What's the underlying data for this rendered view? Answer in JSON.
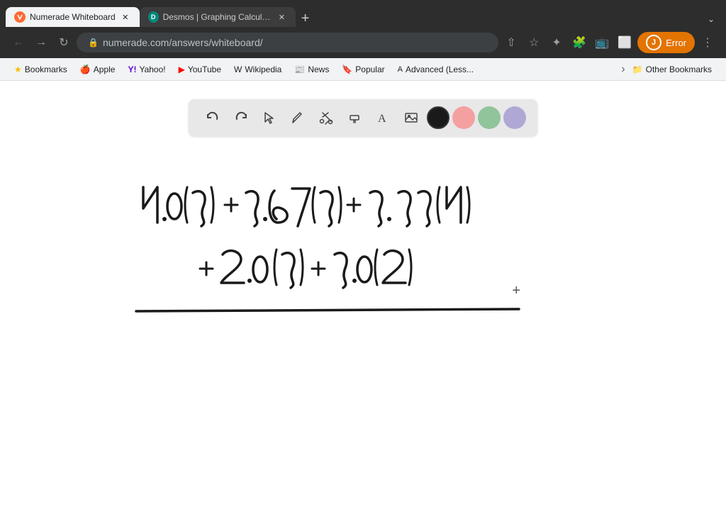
{
  "browser": {
    "tabs": [
      {
        "id": "numerade",
        "title": "Numerade Whiteboard",
        "favicon": "N",
        "active": true
      },
      {
        "id": "desmos",
        "title": "Desmos | Graphing Calculato...",
        "favicon": "D",
        "active": false
      }
    ],
    "new_tab_label": "+",
    "tab_overflow_label": "⌄",
    "address": "numerade.com/answers/whiteboard/",
    "address_prefix": "numerade.com",
    "address_suffix": "/answers/whiteboard/",
    "profile_label": "Error",
    "profile_initial": "J"
  },
  "bookmarks": [
    {
      "id": "bookmarks",
      "label": "Bookmarks",
      "icon": "★"
    },
    {
      "id": "apple",
      "label": "Apple",
      "icon": "🍎"
    },
    {
      "id": "yahoo",
      "label": "Yahoo!",
      "icon": "Y"
    },
    {
      "id": "youtube",
      "label": "YouTube",
      "icon": "▶"
    },
    {
      "id": "wikipedia",
      "label": "Wikipedia",
      "icon": "W"
    },
    {
      "id": "news",
      "label": "News",
      "icon": "📰"
    },
    {
      "id": "popular",
      "label": "Popular",
      "icon": "🔖"
    },
    {
      "id": "advanced",
      "label": "Advanced (Less...",
      "icon": "A"
    }
  ],
  "other_bookmarks": "Other Bookmarks",
  "toolbar": {
    "buttons": [
      {
        "id": "undo",
        "icon": "↩",
        "label": "Undo"
      },
      {
        "id": "redo",
        "icon": "↪",
        "label": "Redo"
      },
      {
        "id": "select",
        "icon": "↗",
        "label": "Select"
      },
      {
        "id": "pencil",
        "icon": "✏",
        "label": "Pencil"
      },
      {
        "id": "tools",
        "icon": "✂",
        "label": "Tools"
      },
      {
        "id": "highlighter",
        "icon": "▬",
        "label": "Highlighter"
      },
      {
        "id": "text",
        "icon": "A",
        "label": "Text"
      },
      {
        "id": "image",
        "icon": "🖼",
        "label": "Image"
      }
    ],
    "colors": [
      {
        "id": "black",
        "hex": "#1a1a1a",
        "label": "Black",
        "active": true
      },
      {
        "id": "pink",
        "hex": "#f4a0a0",
        "label": "Pink",
        "active": false
      },
      {
        "id": "green",
        "hex": "#90c49a",
        "label": "Green",
        "active": false
      },
      {
        "id": "purple",
        "hex": "#b0a8d4",
        "label": "Purple",
        "active": false
      }
    ]
  },
  "canvas": {
    "plus_symbol": "+",
    "expression_line1": "4.0(3) + 3.67(3)+ 3.33(4)",
    "expression_line2": "+ 2.0 (3) + 3.0(2)"
  }
}
